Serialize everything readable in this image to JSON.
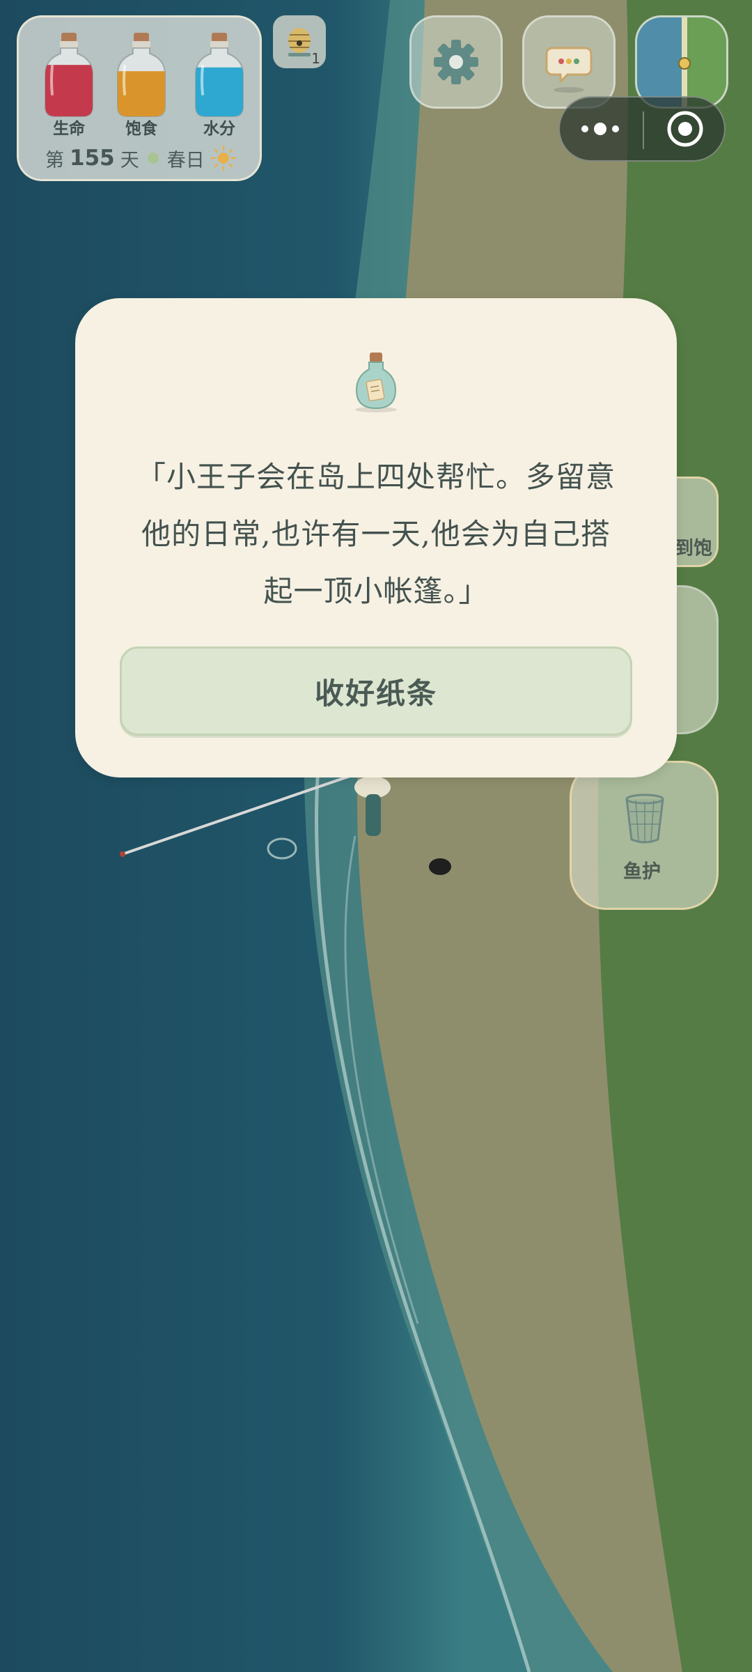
{
  "status": {
    "bars": [
      {
        "label": "生命",
        "color": "#c43a4c",
        "level": 0.82
      },
      {
        "label": "饱食",
        "color": "#d9952c",
        "level": 0.72
      },
      {
        "label": "水分",
        "color": "#2ea8d0",
        "level": 0.78
      }
    ],
    "day_prefix": "第",
    "day_number": "155",
    "day_suffix": "天",
    "season": "春日",
    "weather_icon": "sun-icon"
  },
  "hive": {
    "count": "1",
    "icon": "beehive-icon"
  },
  "top_buttons": {
    "settings_icon": "gear-icon",
    "chat_icon": "chat-bubble-icon",
    "map_icon": "minimap-icon"
  },
  "capsule": {
    "more_icon": "more-dots-icon",
    "close_icon": "target-circle-icon"
  },
  "side_buttons": {
    "top_label_partial": "到饱",
    "fish_protect_label": "鱼护",
    "fish_protect_icon": "fish-net-basket-icon"
  },
  "dialog": {
    "icon": "message-bottle-icon",
    "message_lines": [
      "「小王子会在岛上四处帮忙。多留意",
      "他的日常,也许有一天,他会为自己搭",
      "起一顶小帐篷。」"
    ],
    "button_label": "收好纸条"
  }
}
